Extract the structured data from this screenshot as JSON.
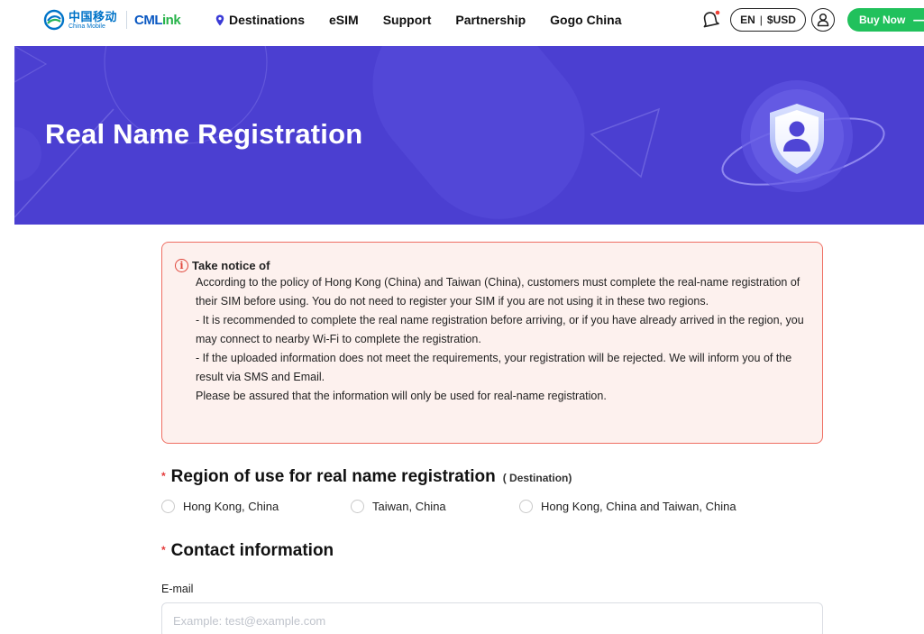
{
  "brand": {
    "logo_zh": "中国移动",
    "logo_en": "China Mobile",
    "cmlink_prefix": "CML",
    "cmlink_suffix": "ink",
    "blue": "#0073c8",
    "green": "#21c15c"
  },
  "nav": {
    "items": [
      {
        "label": "Destinations",
        "icon": "location-pin-icon"
      },
      {
        "label": "eSIM"
      },
      {
        "label": "Support"
      },
      {
        "label": "Partnership"
      },
      {
        "label": "Gogo China"
      }
    ],
    "language": "EN",
    "currency": "$USD",
    "buy_now": "Buy Now",
    "buy_arrow": "⟶"
  },
  "banner": {
    "title": "Real Name Registration",
    "background": "#4b3fd1"
  },
  "notice": {
    "heading": "Take notice of",
    "paragraphs": [
      "According to the policy of Hong Kong (China) and Taiwan (China), customers must complete the real-name registration of their SIM before using. You do not need to register your SIM if you are not using it in these two regions.",
      "- It is recommended to complete the real name registration before arriving, or if you have already arrived in the region, you may connect to nearby Wi-Fi to complete the registration.",
      "- If the uploaded information does not meet the requirements, your registration will be rejected. We will inform you of the result via SMS and Email.",
      "Please be assured that the information will only be used for real-name registration."
    ]
  },
  "region_section": {
    "required_mark": "*",
    "title": "Region of use for real name registration",
    "subtitle": "( Destination)",
    "options": [
      "Hong Kong, China",
      "Taiwan, China",
      "Hong Kong, China and Taiwan, China"
    ]
  },
  "contact_section": {
    "required_mark": "*",
    "title": "Contact information",
    "email_label": "E-mail",
    "email_placeholder": "Example: test@example.com",
    "email_value": ""
  }
}
